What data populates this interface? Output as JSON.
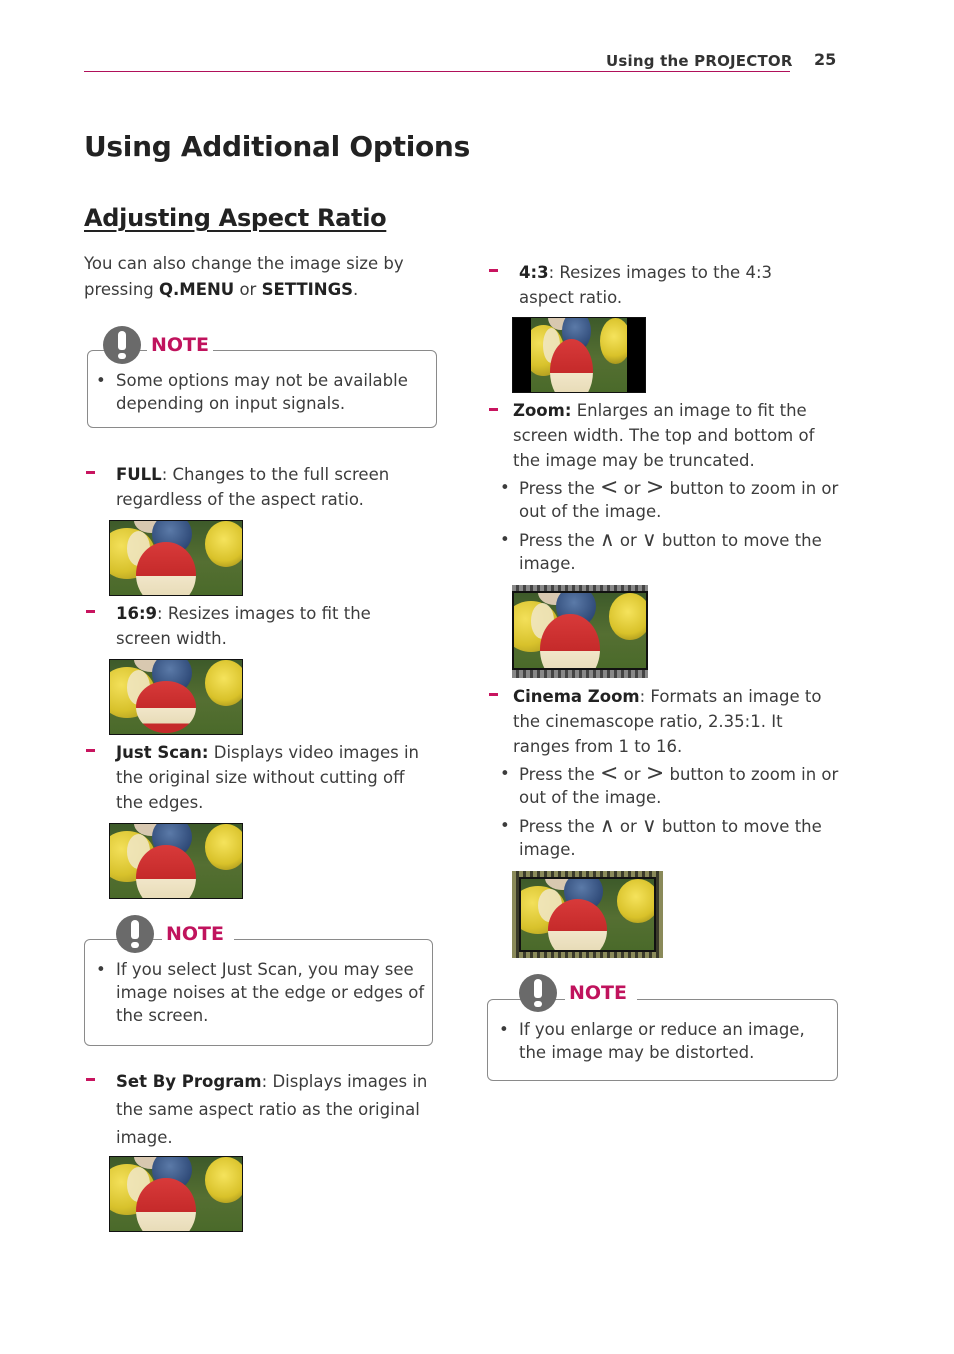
{
  "header": {
    "section": "Using the PROJECTOR",
    "page_number": "25"
  },
  "title": "Using Additional Options",
  "subtitle": "Adjusting Aspect Ratio",
  "intro": {
    "text_1": "You can also change the image size by pressing ",
    "key_1": "Q.MENU",
    "text_2": " or ",
    "key_2": "SETTINGS",
    "text_3": "."
  },
  "notes": [
    {
      "label": "NOTE",
      "bullet": "•",
      "text": "Some options may not be available depending on input signals."
    },
    {
      "label": "NOTE",
      "bullet": "•",
      "text": "If you select Just Scan, you may see image noises at the edge or edges of the screen."
    },
    {
      "label": "NOTE",
      "bullet": "•",
      "text": "If you enlarge or reduce an image, the image may be distorted."
    }
  ],
  "options": [
    {
      "name": "FULL",
      "sep": ": ",
      "desc": "Changes to the full screen regardless of the aspect ratio.",
      "image": "full-aspect-preview"
    },
    {
      "name": "16:9",
      "sep": ": ",
      "desc": "Resizes images to fit the screen width.",
      "image": "16-9-aspect-preview"
    },
    {
      "name": "Just Scan:",
      "sep": " ",
      "desc": "Displays video images in the original size without cutting off the edges.",
      "image": "just-scan-preview"
    },
    {
      "name": "Set By Program",
      "sep": ": ",
      "desc": "Displays images in the same aspect ratio as the original image.",
      "image": "set-by-program-preview"
    },
    {
      "name": "4:3",
      "sep": ": ",
      "desc": "Resizes images to the 4:3 aspect ratio.",
      "image": "4-3-aspect-preview"
    },
    {
      "name": "Zoom:",
      "sep": " ",
      "desc": "Enlarges an image to fit the screen width. The top and bottom of the image may be truncated.",
      "image": "zoom-preview",
      "bullets": [
        {
          "pre": "Press the ",
          "key_a": "<",
          "mid": " or ",
          "key_b": ">",
          "post": " button to zoom in or out of the image."
        },
        {
          "pre": "Press the ",
          "key_a": "∧",
          "mid": " or ",
          "key_b": "∨",
          "post": " button to move the image."
        }
      ]
    },
    {
      "name": "Cinema Zoom",
      "sep": ": ",
      "desc": "Formats an image to the cinemascope ratio, 2.35:1. It ranges from 1 to 16.",
      "image": "cinema-zoom-preview",
      "bullets": [
        {
          "pre": "Press the ",
          "key_a": "<",
          "mid": " or ",
          "key_b": ">",
          "post": " button to zoom in or out of the image."
        },
        {
          "pre": "Press the ",
          "key_a": "∧",
          "mid": " or ",
          "key_b": "∨",
          "post": " button to move the image."
        }
      ]
    }
  ],
  "colors": {
    "accent": "#c8145f",
    "note_icon": "#6a6a6a",
    "border": "#8a8a8a"
  }
}
